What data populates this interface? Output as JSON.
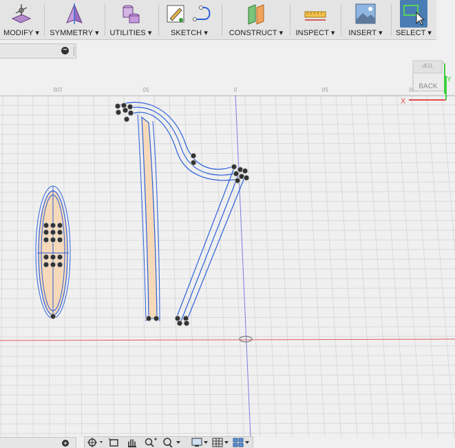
{
  "toolbar": {
    "groups": [
      {
        "label": "MODIFY ▾",
        "icon": "modify-icon"
      },
      {
        "label": "SYMMETRY ▾",
        "icon": "symmetry-icon"
      },
      {
        "label": "UTILITIES ▾",
        "icon": "utilities-icon"
      },
      {
        "label": "SKETCH ▾",
        "icon": "sketch-icon"
      },
      {
        "label": "CONSTRUCT ▾",
        "icon": "construct-icon"
      },
      {
        "label": "INSPECT ▾",
        "icon": "inspect-icon"
      },
      {
        "label": "INSERT ▾",
        "icon": "insert-icon"
      },
      {
        "label": "SELECT ▾",
        "icon": "select-icon"
      }
    ],
    "active": "SELECT ▾"
  },
  "browser": {
    "collapse_symbol": "−"
  },
  "comments": {
    "add_symbol": "+"
  },
  "viewcube": {
    "face_label": "BACK",
    "top_label": "TOP",
    "axis_x": "X",
    "axis_y": "Y"
  },
  "ruler": {
    "labels": [
      "100",
      "50",
      "0",
      "50",
      "100"
    ]
  },
  "colors": {
    "accent": "#4a7db3",
    "sketch_line": "#2b5fd9",
    "profile_fill": "#f6d9b9",
    "grid": "#d9d9d9",
    "x_axis": "#e25a5a",
    "y_axis": "#7b7bdf"
  },
  "navbar": {
    "icons": [
      "orbit-icon",
      "look-at-icon",
      "pan-icon",
      "zoom-icon",
      "fit-icon",
      "display-settings-icon",
      "grid-settings-icon",
      "viewports-icon"
    ]
  }
}
